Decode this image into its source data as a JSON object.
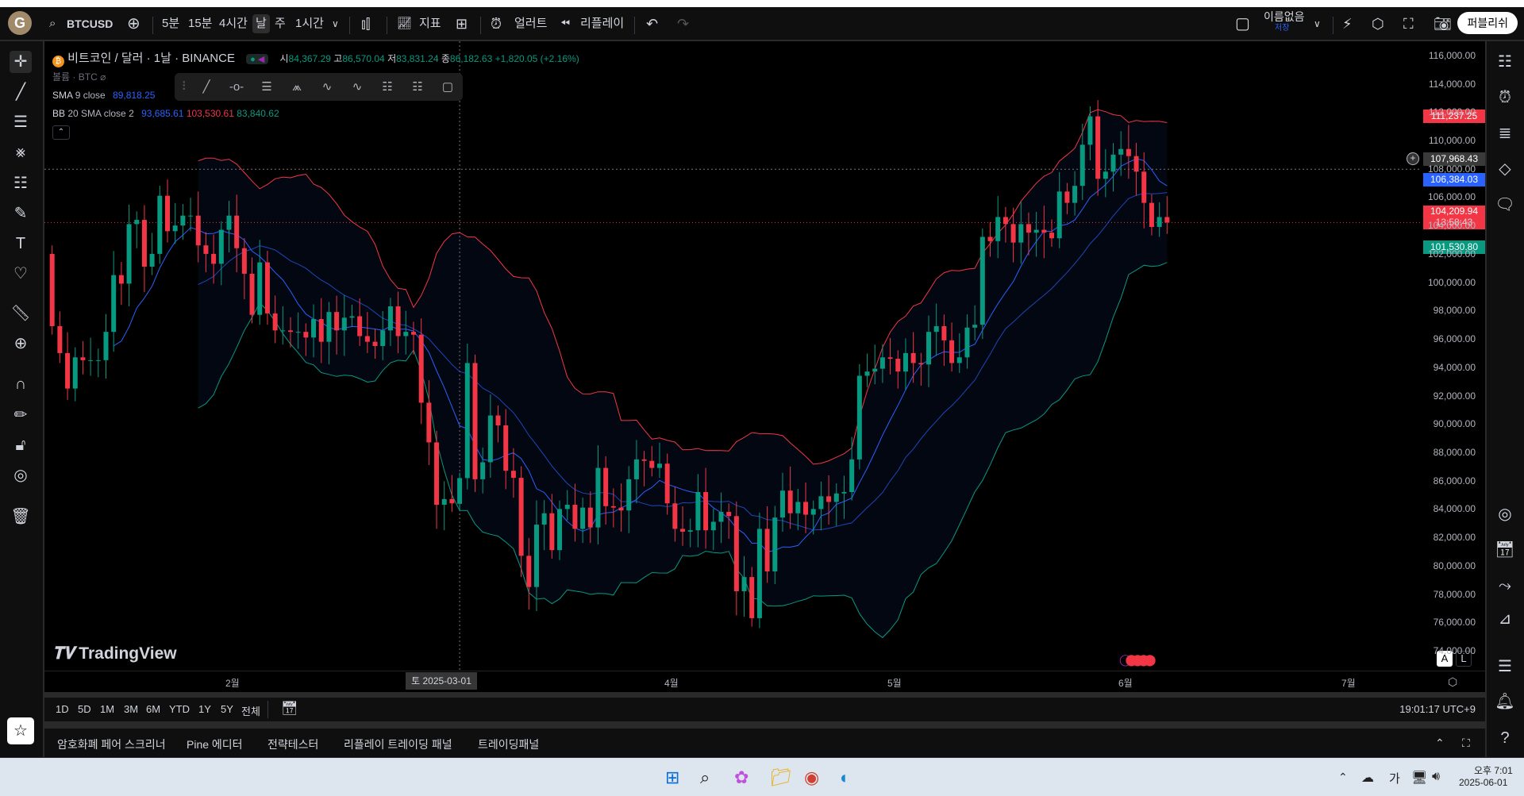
{
  "toolbar": {
    "avatar": "G",
    "symbol": "BTCUSD",
    "intervals": [
      "5분",
      "15분",
      "4시간",
      "날",
      "주",
      "1시간"
    ],
    "selected_interval": "날",
    "indicators": "지표",
    "alert": "얼러트",
    "replay": "리플레이",
    "layout_name": "이름없음",
    "save": "저장",
    "publish": "퍼블리쉬"
  },
  "legend": {
    "title": "비트코인 / 달러 · 1날 · BINANCE",
    "o_label": "시",
    "o": "84,367.29",
    "h_label": "고",
    "h": "86,570.04",
    "l_label": "저",
    "l": "83,831.24",
    "c_label": "종",
    "c": "86,182.63",
    "change": "+1,820.05 (+2.16%)",
    "volume": "볼륨 · BTC",
    "sma_name": "SMA",
    "sma_params": "9 close",
    "sma_value": "89,818.25",
    "bb_name": "BB",
    "bb_params": "20 SMA close 2",
    "bb_basis": "93,685.61",
    "bb_upper": "103,530.61",
    "bb_lower": "83,840.62"
  },
  "price_labels": {
    "bb_upper": "111,237.25",
    "crosshair": "107,968.43",
    "sma": "106,384.03",
    "last": "104,209.94",
    "countdown": "13:58:43",
    "bb_lower": "101,530.80"
  },
  "time_axis": {
    "ticks": [
      "2월",
      "4월",
      "5월",
      "6월",
      "7월"
    ],
    "crosshair": "토 2025-03-01"
  },
  "watermark": "TradingView",
  "scale_buttons": {
    "auto": "A",
    "log": "L"
  },
  "range_bar": {
    "ranges": [
      "1D",
      "5D",
      "1M",
      "3M",
      "6M",
      "YTD",
      "1Y",
      "5Y",
      "전체"
    ],
    "clock": "19:01:17 UTC+9"
  },
  "bottom_panel": {
    "tabs": [
      "암호화폐 페어 스크리너",
      "Pine 에디터",
      "전략테스터",
      "리플레이 트레이딩 패널",
      "트레이딩패널"
    ]
  },
  "taskbar": {
    "ime": "가",
    "time": "오후 7:01",
    "date": "2025-06-01"
  },
  "colors": {
    "up": "#089981",
    "down": "#f23645",
    "sma": "#2962ff",
    "bb_upper": "#f23645",
    "bb_lower": "#089981",
    "bb_basis": "#2962ff"
  },
  "chart_data": {
    "type": "candlestick",
    "symbol": "BTCUSD",
    "interval": "1D",
    "start_date": "2025-01-07",
    "first_open": 102000,
    "close": [
      96900,
      95000,
      92500,
      94700,
      94500,
      94500,
      94500,
      96500,
      100500,
      99900,
      104100,
      104400,
      101100,
      102000,
      106100,
      103600,
      104000,
      104700,
      104700,
      102600,
      102000,
      101300,
      103700,
      104700,
      102400,
      100600,
      97700,
      101400,
      97800,
      96600,
      96600,
      96500,
      96500,
      96100,
      97400,
      95800,
      97900,
      96600,
      97500,
      97600,
      96200,
      95800,
      95500,
      96600,
      98300,
      96200,
      96500,
      96300,
      91500,
      88700,
      84300,
      84700,
      84400,
      86182.63,
      94300,
      86100,
      87300,
      90600,
      89900,
      86700,
      86200,
      80700,
      78500,
      82900,
      83700,
      81100,
      84000,
      84300,
      82600,
      84100,
      82700,
      86900,
      84200,
      84100,
      83900,
      86100,
      87500,
      87400,
      86900,
      87200,
      84400,
      82600,
      82400,
      82500,
      85200,
      82500,
      83100,
      83800,
      83500,
      78200,
      79200,
      76300,
      82600,
      79600,
      83400,
      85300,
      83700,
      84500,
      83600,
      84000,
      84900,
      84500,
      85100,
      85200,
      87500,
      93400,
      93700,
      93900,
      94700,
      94600,
      93700,
      95000,
      94300,
      94200,
      96500,
      96900,
      95900,
      94300,
      94700,
      96800,
      97000,
      103200,
      102900,
      104600,
      104100,
      102800,
      104100,
      103500,
      103700,
      103500,
      103100,
      106400,
      105600,
      106800,
      109700,
      111700,
      107300,
      107800,
      109000,
      109400,
      108900,
      107800,
      105600,
      103900,
      104600,
      104209.94
    ],
    "crosshair_candle": {
      "date": "2025-03-01",
      "open": 84367.29,
      "high": 86570.04,
      "low": 83831.24,
      "close": 86182.63
    },
    "y_ticks": [
      116000,
      114000,
      112000,
      110000,
      108000,
      106000,
      104000,
      102000,
      100000,
      98000,
      96000,
      94000,
      92000,
      90000,
      88000,
      86000,
      84000,
      82000,
      80000,
      78000,
      76000,
      74000
    ],
    "ylim": [
      72600,
      117000
    ],
    "xlim": [
      "2025-01-06",
      "2025-07-04"
    ],
    "crosshair_price": 107968.43,
    "last_price": 104209.94,
    "indicators": [
      {
        "name": "SMA",
        "length": 9,
        "source": "close"
      },
      {
        "name": "BB",
        "length": 20,
        "basis": "SMA",
        "source": "close",
        "mult": 2
      }
    ]
  }
}
